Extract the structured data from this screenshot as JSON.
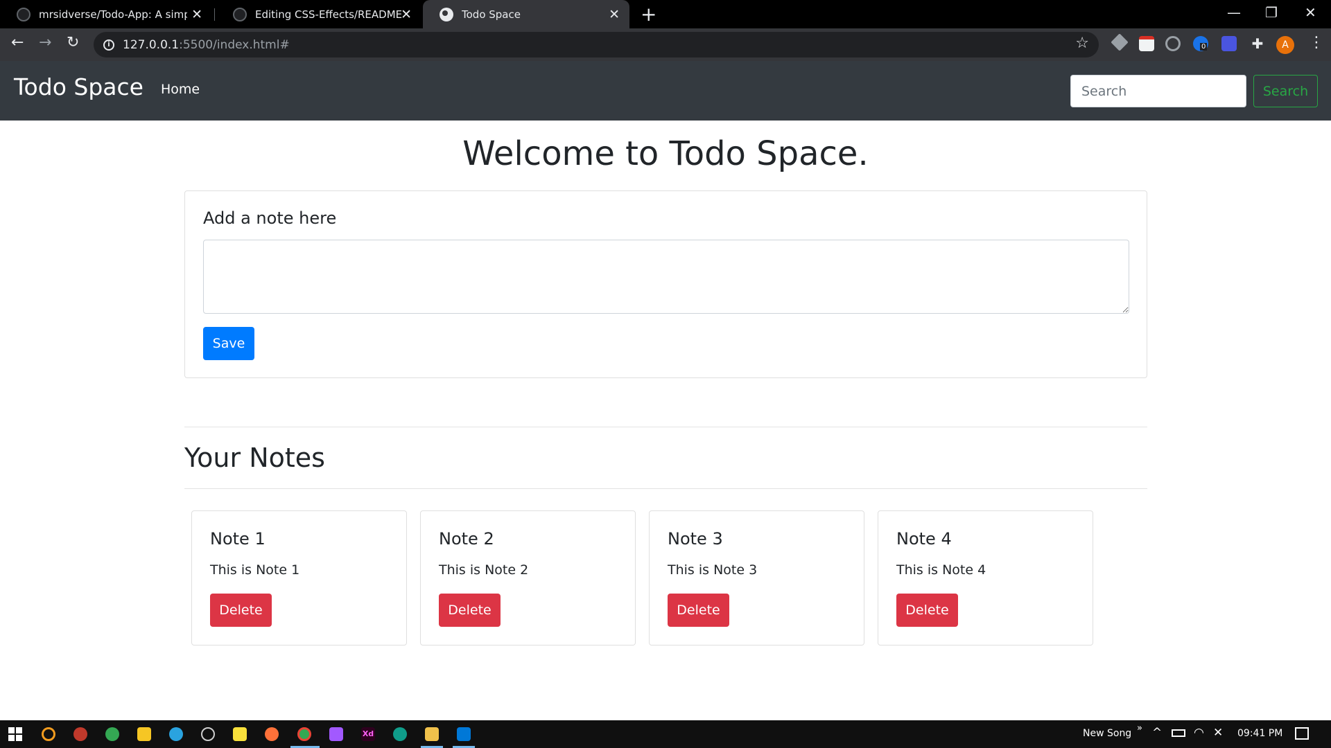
{
  "browser": {
    "tabs": [
      {
        "title": "mrsidverse/Todo-App: A simple t"
      },
      {
        "title": "Editing CSS-Effects/README.md"
      },
      {
        "title": "Todo Space"
      }
    ],
    "url_host": "127.0.0.1",
    "url_rest": ":5500/index.html#",
    "profile_initial": "A",
    "extension_badge": "0"
  },
  "navbar": {
    "brand": "Todo Space",
    "home_link": "Home",
    "search_placeholder": "Search",
    "search_button": "Search"
  },
  "main": {
    "heading": "Welcome to Todo Space.",
    "add_note_title": "Add a note here",
    "save_label": "Save",
    "notes_heading": "Your Notes"
  },
  "notes": [
    {
      "title": "Note 1",
      "text": "This is Note 1",
      "delete_label": "Delete"
    },
    {
      "title": "Note 2",
      "text": "This is Note 2",
      "delete_label": "Delete"
    },
    {
      "title": "Note 3",
      "text": "This is Note 3",
      "delete_label": "Delete"
    },
    {
      "title": "Note 4",
      "text": "This is Note 4",
      "delete_label": "Delete"
    }
  ],
  "taskbar": {
    "media_title": "New Song",
    "time": "09:41 PM"
  },
  "colors": {
    "navbar_bg": "#343a40",
    "primary": "#007bff",
    "danger": "#dc3545",
    "success": "#28a745"
  }
}
